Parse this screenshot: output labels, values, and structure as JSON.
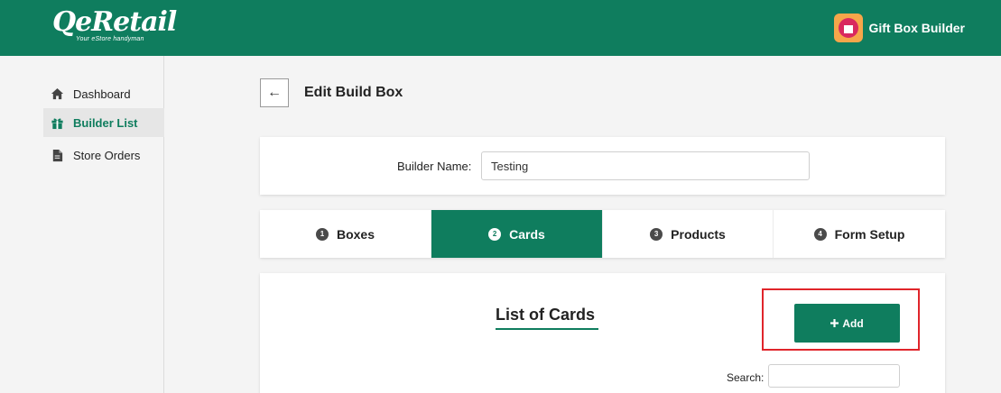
{
  "header": {
    "logo_text": "QeRetail",
    "logo_tagline": "Your eStore handyman",
    "app_name": "Gift Box Builder",
    "brand_color": "#0f7d5e"
  },
  "sidebar": {
    "items": [
      {
        "label": "Dashboard",
        "icon": "home-icon"
      },
      {
        "label": "Builder List",
        "icon": "gift-icon",
        "active": true
      },
      {
        "label": "Store Orders",
        "icon": "document-icon"
      }
    ]
  },
  "page": {
    "back_symbol": "←",
    "title": "Edit Build Box"
  },
  "builder": {
    "name_label": "Builder Name:",
    "name_value": "Testing"
  },
  "tabs": [
    {
      "num": "1",
      "label": "Boxes"
    },
    {
      "num": "2",
      "label": "Cards",
      "active": true
    },
    {
      "num": "3",
      "label": "Products"
    },
    {
      "num": "4",
      "label": "Form Setup"
    }
  ],
  "list": {
    "title": "List of Cards",
    "add_label": "Add",
    "add_icon": "plus-icon",
    "search_label": "Search:",
    "search_value": ""
  }
}
